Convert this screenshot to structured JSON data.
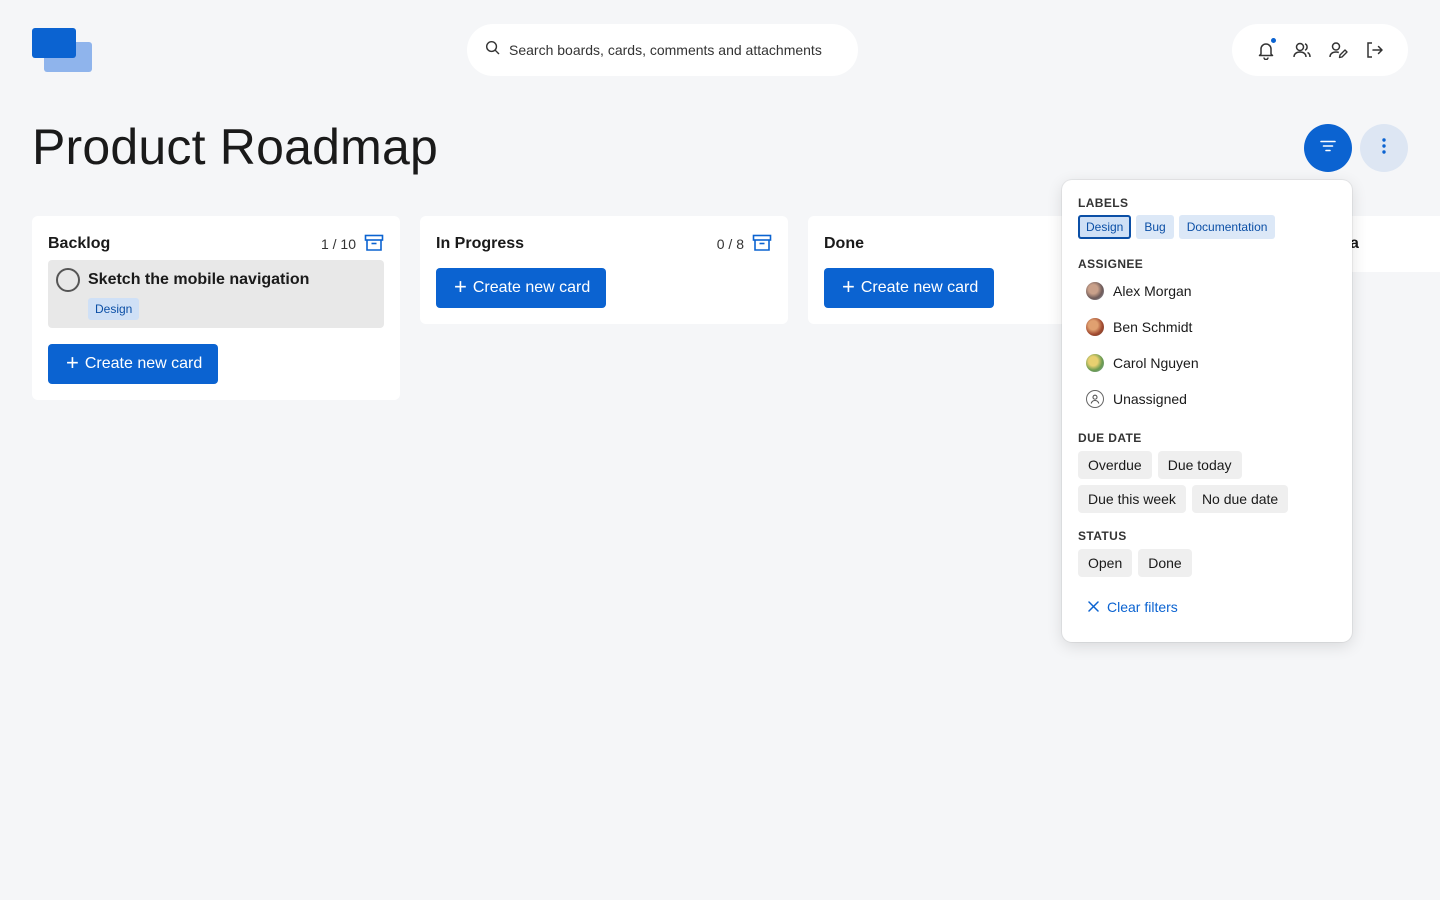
{
  "app": {
    "logo": "boards-logo"
  },
  "search": {
    "placeholder": "Search boards, cards, comments and attachments"
  },
  "top_icons": [
    "bell-icon",
    "users-icon",
    "user-edit-icon",
    "logout-icon"
  ],
  "page": {
    "title": "Product Roadmap"
  },
  "toolbar": {
    "filter_icon": "filter-icon",
    "more_icon": "more-vertical-icon"
  },
  "columns": [
    {
      "title": "Backlog",
      "count": "1 / 10",
      "cards": [
        {
          "title": "Sketch the mobile navigation",
          "tag": "Design"
        }
      ],
      "create_label": "Create new card"
    },
    {
      "title": "In Progress",
      "count": "0 / 8",
      "cards": [],
      "create_label": "Create new card"
    },
    {
      "title": "Done",
      "count": "",
      "cards": [],
      "create_label": "Create new card"
    },
    {
      "title": "a"
    }
  ],
  "filters": {
    "labels_title": "LABELS",
    "labels": [
      "Design",
      "Bug",
      "Documentation"
    ],
    "active_label": "Design",
    "assignee_title": "ASSIGNEE",
    "assignees": [
      "Alex Morgan",
      "Ben Schmidt",
      "Carol Nguyen",
      "Unassigned"
    ],
    "due_title": "DUE DATE",
    "due": [
      "Overdue",
      "Due today",
      "Due this week",
      "No due date"
    ],
    "status_title": "STATUS",
    "status": [
      "Open",
      "Done"
    ],
    "clear_label": "Clear filters"
  },
  "colors": {
    "accent": "#0b63d1",
    "background": "#f5f6f8",
    "tag_bg": "#cfe0f6"
  }
}
